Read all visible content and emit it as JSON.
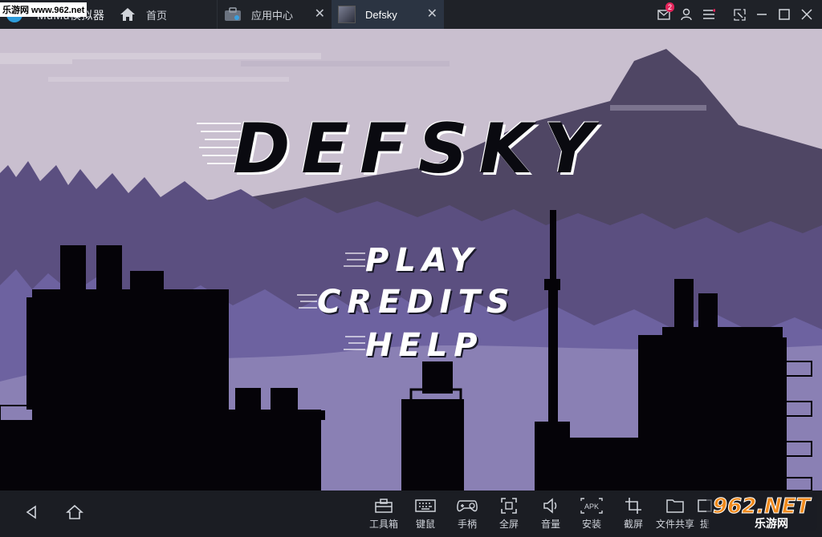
{
  "app": {
    "name": "MuMu模拟器"
  },
  "watermark_top": "乐游网 www.962.net",
  "tabs": [
    {
      "label": "首页"
    },
    {
      "label": "应用中心"
    },
    {
      "label": "Defsky"
    }
  ],
  "titlebar": {
    "notification_count": "2"
  },
  "game": {
    "logo": "DEFSKY",
    "menu": [
      "PLAY",
      "CREDITS",
      "HELP"
    ]
  },
  "toolbar": {
    "items": [
      {
        "label": "工具箱",
        "icon": "toolbox-icon"
      },
      {
        "label": "键鼠",
        "icon": "keyboard-icon"
      },
      {
        "label": "手柄",
        "icon": "gamepad-icon"
      },
      {
        "label": "全屏",
        "icon": "fullscreen-icon"
      },
      {
        "label": "音量",
        "icon": "volume-icon"
      },
      {
        "label": "安装",
        "icon": "apk-install-icon"
      },
      {
        "label": "截屏",
        "icon": "crop-icon"
      },
      {
        "label": "文件共享",
        "icon": "folder-icon"
      },
      {
        "label": "提",
        "icon": "extra-icon"
      }
    ]
  },
  "watermark_bottom": {
    "brand": "962.NET",
    "name": "乐游网"
  },
  "colors": {
    "sky": "#c9bfcf",
    "mountain": "#4f4664",
    "forest": "#5b4f80",
    "silhouette": "#050308",
    "titlebar": "#1f2228"
  }
}
